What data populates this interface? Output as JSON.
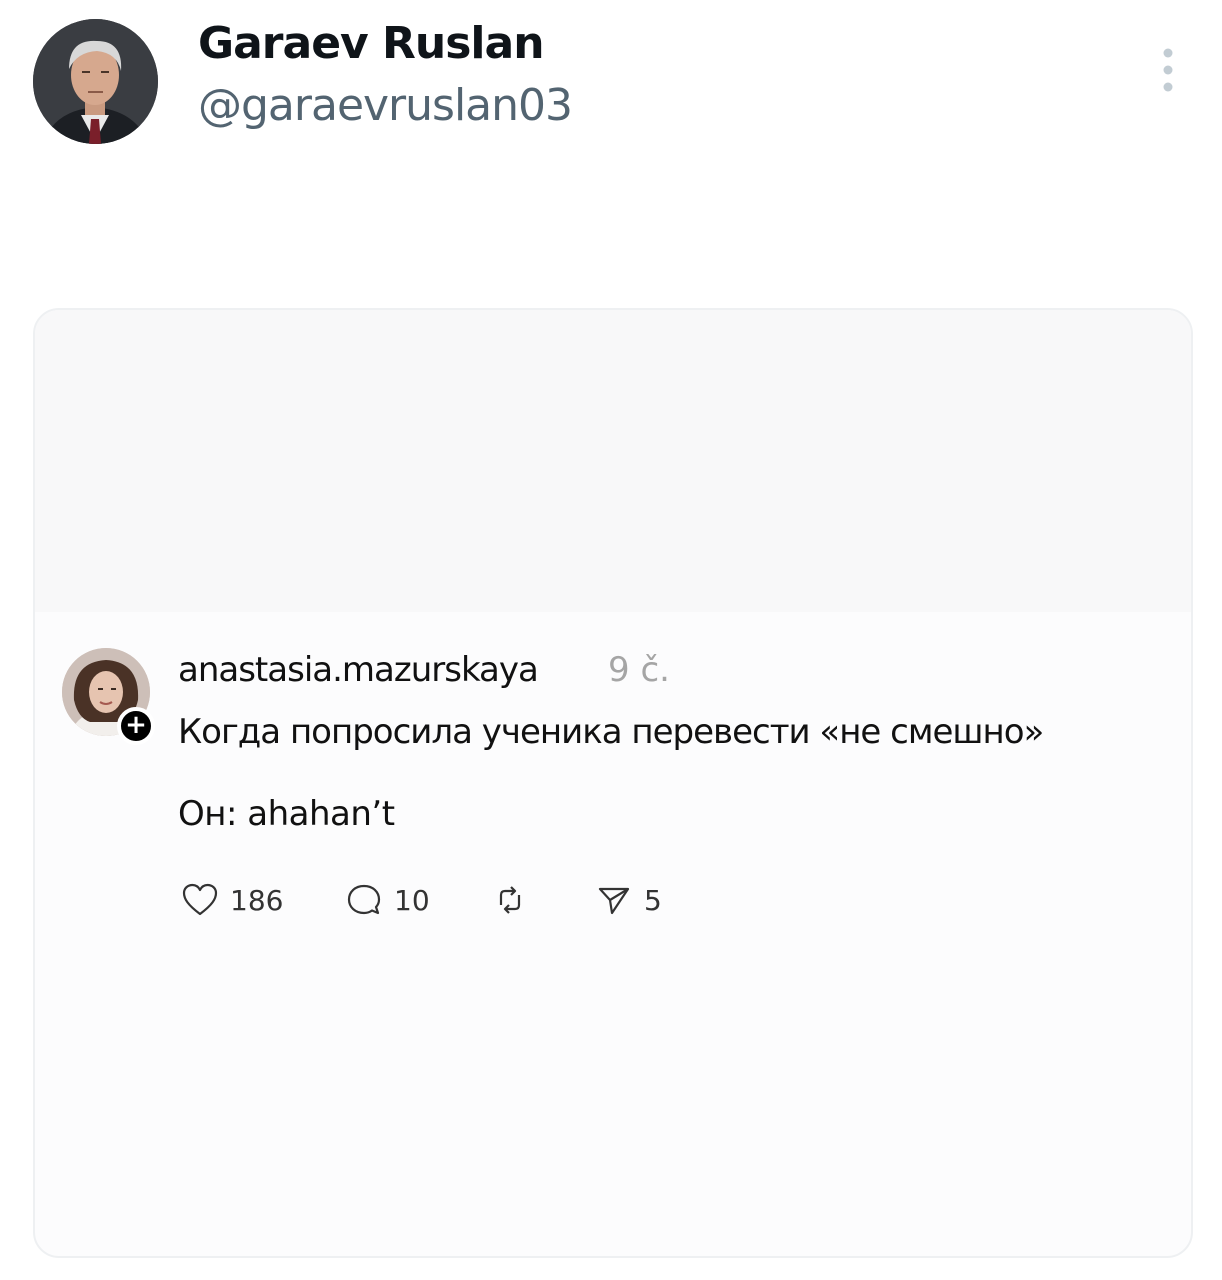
{
  "tweet": {
    "author": {
      "display_name": "Garaev Ruslan",
      "handle": "@garaevruslan03"
    },
    "more_icon": "more-vertical-icon"
  },
  "embedded_post": {
    "username": "anastasia.mazurskaya",
    "time": "9 č.",
    "text_line1": "Когда попросила ученика перевести «не смешно»",
    "text_line2": "Он: ahahan’t",
    "follow_badge": "+",
    "actions": {
      "likes": "186",
      "replies": "10",
      "reposts": "",
      "shares": "5"
    },
    "icons": [
      "heart-icon",
      "comment-icon",
      "repost-icon",
      "send-icon"
    ]
  }
}
